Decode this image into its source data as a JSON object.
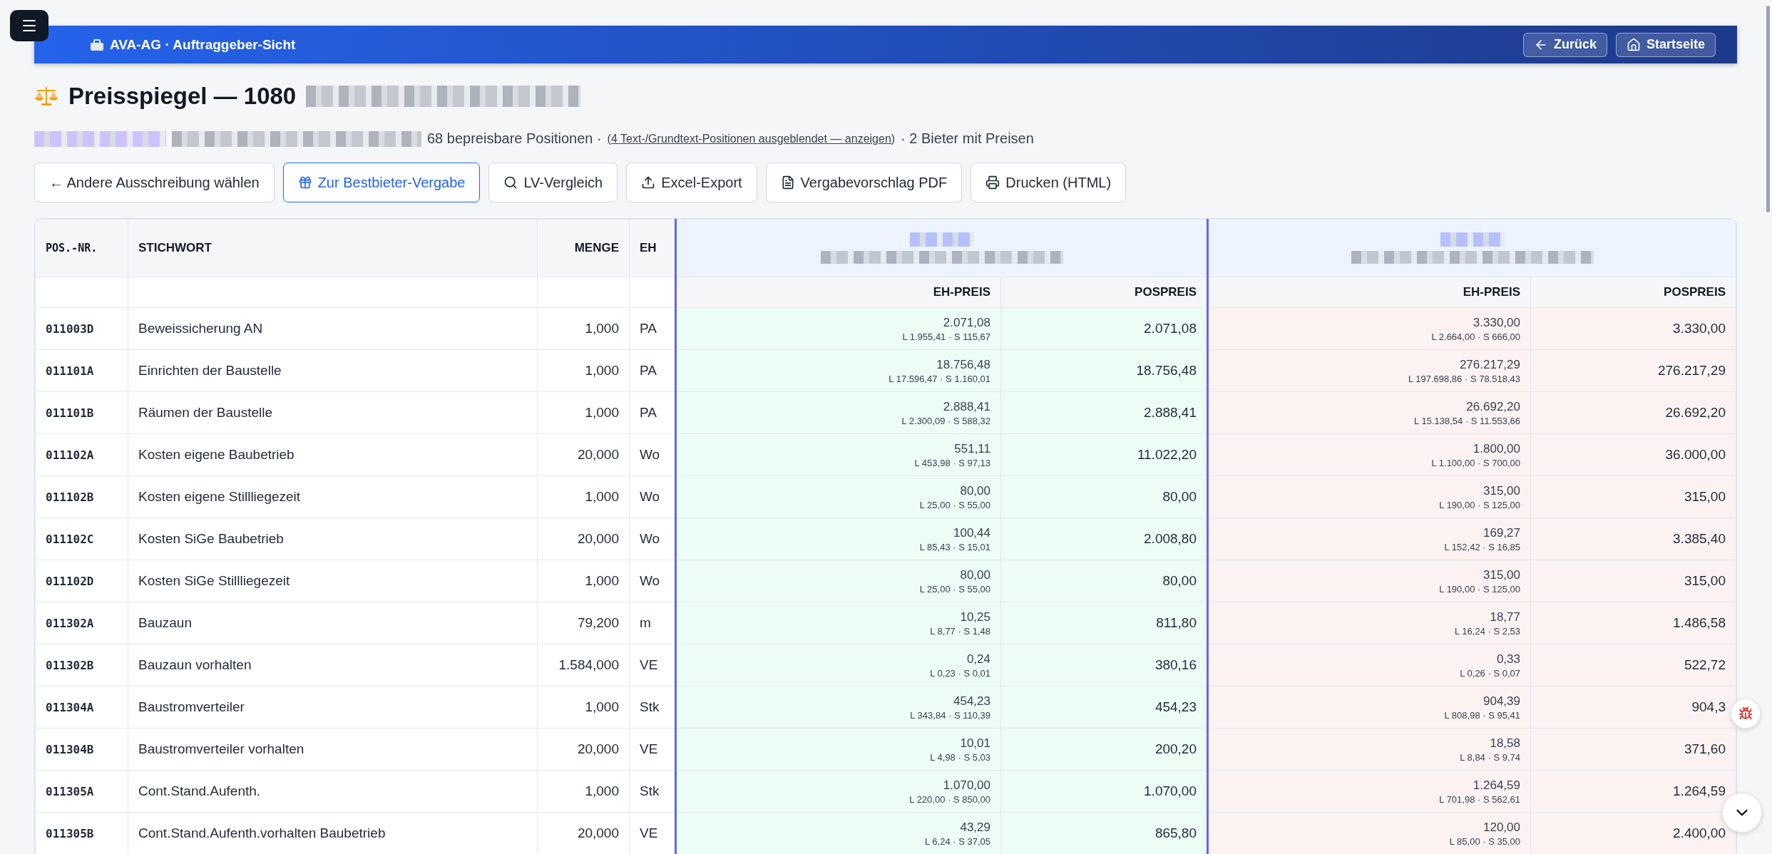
{
  "app_bar": {
    "title": "AVA-AG · Auftraggeber-Sicht",
    "buttons": [
      {
        "label": "Zurück"
      },
      {
        "label": "Startseite"
      }
    ]
  },
  "page": {
    "title": "Preisspiegel — 1080",
    "subtitle_count": "68 bepreisbare Positionen ·",
    "subtitle_link": "(4 Text-/Grundtext-Positionen ausgeblendet — anzeigen)",
    "subtitle_bidders": "· 2 Bieter mit Preisen"
  },
  "actions": [
    {
      "label": "← Andere Ausschreibung wählen",
      "selected": false
    },
    {
      "label": "Zur Bestbieter-Vergabe",
      "selected": true
    },
    {
      "label": "LV-Vergleich",
      "selected": false
    },
    {
      "label": "Excel-Export",
      "selected": false
    },
    {
      "label": "Vergabevorschlag PDF",
      "selected": false
    },
    {
      "label": "Drucken (HTML)",
      "selected": false
    }
  ],
  "table": {
    "columns": [
      "POS.-NR.",
      "STICHWORT",
      "MENGE",
      "EH"
    ],
    "bidders": [
      {
        "best": true,
        "columns": [
          "EH-PREIS",
          "POSPREIS"
        ]
      },
      {
        "best": false,
        "columns": [
          "EH-PREIS",
          "POSPREIS"
        ]
      }
    ],
    "rows": [
      {
        "pos": "011003D",
        "text": "Beweissicherung AN",
        "qty": "1,000",
        "unit": "PA",
        "bids": [
          {
            "unit_price": "2.071,08",
            "split": "L 1.955,41 · S 115,67",
            "total": "2.071,08"
          },
          {
            "unit_price": "3.330,00",
            "split": "L 2.664,00 · S 666,00",
            "total": "3.330,00"
          }
        ]
      },
      {
        "pos": "011101A",
        "text": "Einrichten der Baustelle",
        "qty": "1,000",
        "unit": "PA",
        "bids": [
          {
            "unit_price": "18.756,48",
            "split": "L 17.596,47 · S 1.160,01",
            "total": "18.756,48"
          },
          {
            "unit_price": "276.217,29",
            "split": "L 197.698,86 · S 78.518,43",
            "total": "276.217,29"
          }
        ]
      },
      {
        "pos": "011101B",
        "text": "Räumen der Baustelle",
        "qty": "1,000",
        "unit": "PA",
        "bids": [
          {
            "unit_price": "2.888,41",
            "split": "L 2.300,09 · S 588,32",
            "total": "2.888,41"
          },
          {
            "unit_price": "26.692,20",
            "split": "L 15.138,54 · S 11.553,66",
            "total": "26.692,20"
          }
        ]
      },
      {
        "pos": "011102A",
        "text": "Kosten eigene Baubetrieb",
        "qty": "20,000",
        "unit": "Wo",
        "bids": [
          {
            "unit_price": "551,11",
            "split": "L 453,98 · S 97,13",
            "total": "11.022,20"
          },
          {
            "unit_price": "1.800,00",
            "split": "L 1.100,00 · S 700,00",
            "total": "36.000,00"
          }
        ]
      },
      {
        "pos": "011102B",
        "text": "Kosten eigene Stillliegezeit",
        "qty": "1,000",
        "unit": "Wo",
        "bids": [
          {
            "unit_price": "80,00",
            "split": "L 25,00 · S 55,00",
            "total": "80,00"
          },
          {
            "unit_price": "315,00",
            "split": "L 190,00 · S 125,00",
            "total": "315,00"
          }
        ]
      },
      {
        "pos": "011102C",
        "text": "Kosten SiGe Baubetrieb",
        "qty": "20,000",
        "unit": "Wo",
        "bids": [
          {
            "unit_price": "100,44",
            "split": "L 85,43 · S 15,01",
            "total": "2.008,80"
          },
          {
            "unit_price": "169,27",
            "split": "L 152,42 · S 16,85",
            "total": "3.385,40"
          }
        ]
      },
      {
        "pos": "011102D",
        "text": "Kosten SiGe Stillliegezeit",
        "qty": "1,000",
        "unit": "Wo",
        "bids": [
          {
            "unit_price": "80,00",
            "split": "L 25,00 · S 55,00",
            "total": "80,00"
          },
          {
            "unit_price": "315,00",
            "split": "L 190,00 · S 125,00",
            "total": "315,00"
          }
        ]
      },
      {
        "pos": "011302A",
        "text": "Bauzaun",
        "qty": "79,200",
        "unit": "m",
        "bids": [
          {
            "unit_price": "10,25",
            "split": "L 8,77 · S 1,48",
            "total": "811,80"
          },
          {
            "unit_price": "18,77",
            "split": "L 16,24 · S 2,53",
            "total": "1.486,58"
          }
        ]
      },
      {
        "pos": "011302B",
        "text": "Bauzaun vorhalten",
        "qty": "1.584,000",
        "unit": "VE",
        "bids": [
          {
            "unit_price": "0,24",
            "split": "L 0,23 · S 0,01",
            "total": "380,16"
          },
          {
            "unit_price": "0,33",
            "split": "L 0,26 · S 0,07",
            "total": "522,72"
          }
        ]
      },
      {
        "pos": "011304A",
        "text": "Baustromverteiler",
        "qty": "1,000",
        "unit": "Stk",
        "bids": [
          {
            "unit_price": "454,23",
            "split": "L 343,84 · S 110,39",
            "total": "454,23"
          },
          {
            "unit_price": "904,39",
            "split": "L 808,98 · S 95,41",
            "total": "904,3"
          }
        ]
      },
      {
        "pos": "011304B",
        "text": "Baustromverteiler vorhalten",
        "qty": "20,000",
        "unit": "VE",
        "bids": [
          {
            "unit_price": "10,01",
            "split": "L 4,98 · S 5,03",
            "total": "200,20"
          },
          {
            "unit_price": "18,58",
            "split": "L 8,84 · S 9,74",
            "total": "371,60"
          }
        ]
      },
      {
        "pos": "011305A",
        "text": "Cont.Stand.Aufenth.",
        "qty": "1,000",
        "unit": "Stk",
        "bids": [
          {
            "unit_price": "1.070,00",
            "split": "L 220,00 · S 850,00",
            "total": "1.070,00"
          },
          {
            "unit_price": "1.264,59",
            "split": "L 701,98 · S 562,61",
            "total": "1.264,59"
          }
        ]
      },
      {
        "pos": "011305B",
        "text": "Cont.Stand.Aufenth.vorhalten Baubetrieb",
        "qty": "20,000",
        "unit": "VE",
        "bids": [
          {
            "unit_price": "43,29",
            "split": "L 6,24 · S 37,05",
            "total": "865,80"
          },
          {
            "unit_price": "120,00",
            "split": "L 85,00 · S 35,00",
            "total": "2.400,00"
          }
        ]
      }
    ]
  }
}
